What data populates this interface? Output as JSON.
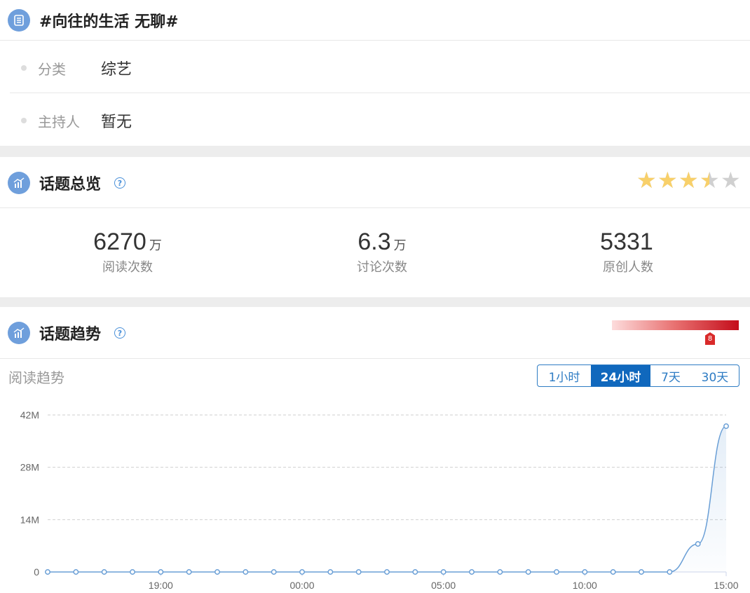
{
  "topic": {
    "title": "#向往的生活 无聊#",
    "info": [
      {
        "label": "分类",
        "value": "综艺"
      },
      {
        "label": "主持人",
        "value": "暂无"
      }
    ]
  },
  "overview": {
    "title": "话题总览",
    "help_icon": "question-circle-icon",
    "rating": 3.5,
    "rating_max": 5,
    "stats": [
      {
        "value": "6270",
        "unit": "万",
        "label": "阅读次数"
      },
      {
        "value": "6.3",
        "unit": "万",
        "label": "讨论次数"
      },
      {
        "value": "5331",
        "unit": "",
        "label": "原创人数"
      }
    ]
  },
  "trend": {
    "title": "话题趋势",
    "heat_level": "8",
    "subtitle": "阅读趋势",
    "ranges": [
      "1小时",
      "24小时",
      "7天",
      "30天"
    ],
    "active_range": "24小时",
    "colors": {
      "accent": "#1068bd",
      "line": "#6a9fd6",
      "heat_max": "#c40d1a"
    }
  },
  "chart_data": {
    "type": "area",
    "ylabels": [
      "42M",
      "28M",
      "14M",
      "0"
    ],
    "xlabels": [
      "19:00",
      "00:00",
      "05:00",
      "10:00",
      "15:00"
    ],
    "ylim": [
      0,
      42
    ],
    "grid": true,
    "series": [
      {
        "values": [
          0,
          0,
          0,
          0,
          0,
          0,
          0,
          0,
          0,
          0,
          0,
          0,
          0,
          0,
          0,
          0,
          0,
          0,
          0,
          0,
          0,
          0,
          0,
          7.5,
          39
        ]
      }
    ]
  }
}
